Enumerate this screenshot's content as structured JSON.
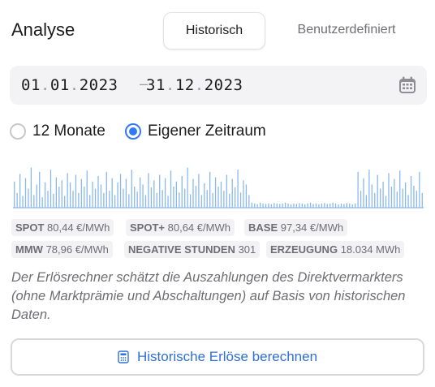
{
  "header": {
    "title": "Analyse"
  },
  "tabs": [
    {
      "label": "Historisch",
      "active": true
    },
    {
      "label": "Benutzerdefiniert",
      "active": false
    }
  ],
  "date_range": {
    "start": {
      "day": "01",
      "month": "01",
      "year": "2023"
    },
    "separator": "–",
    "end": {
      "day": "31",
      "month": "12",
      "year": "2023"
    },
    "calendar_icon": "calendar-icon"
  },
  "period_options": [
    {
      "label": "12 Monate",
      "selected": false
    },
    {
      "label": "Eigener Zeitraum",
      "selected": true
    }
  ],
  "stats": [
    {
      "key": "SPOT",
      "value": "80,44 €/MWh"
    },
    {
      "key": "SPOT+",
      "value": "80,64 €/MWh"
    },
    {
      "key": "BASE",
      "value": "97,34 €/MWh"
    },
    {
      "key": "MMW",
      "value": "78,96 €/MWh"
    },
    {
      "key": "NEGATIVE STUNDEN",
      "value": "301"
    },
    {
      "key": "ERZEUGUNG",
      "value": "18.034 MWh"
    }
  ],
  "description": "Der Erlösrechner schätzt die Auszahlungen des Direktvermarkters (ohne Marktprämie und Abschaltungen) auf Basis von historischen Daten.",
  "calculate_button": {
    "label": "Historische Erlöse berechnen",
    "icon": "calculator-icon"
  },
  "colors": {
    "accent": "#3478f6",
    "chart": "#8ab8ee",
    "button_text": "#2f6fd6"
  },
  "chart_data": {
    "type": "area",
    "series": [
      {
        "values": [
          0.62,
          0.35,
          0.8,
          0.28,
          0.7,
          0.45,
          0.95,
          0.3,
          0.55,
          0.85,
          0.25,
          0.6,
          0.4,
          0.9,
          0.33,
          0.72,
          0.5,
          0.65,
          0.28,
          0.82,
          0.6,
          0.4,
          0.78,
          0.35,
          0.68,
          0.5,
          0.88,
          0.3,
          0.62,
          0.45,
          0.75,
          0.55,
          0.35,
          0.85,
          0.4,
          0.7,
          0.3,
          0.6,
          0.8,
          0.45,
          0.68,
          0.32,
          0.9,
          0.5,
          0.38,
          0.72,
          0.55,
          0.3,
          0.82,
          0.48,
          0.65,
          0.35,
          0.78,
          0.42,
          0.7,
          0.28,
          0.88,
          0.5,
          0.62,
          0.36,
          0.75,
          0.45,
          0.95,
          0.32,
          0.68,
          0.52,
          0.8,
          0.3,
          0.58,
          0.42,
          0.85,
          0.35,
          0.72,
          0.5,
          0.62,
          0.4,
          0.78,
          0.33,
          0.68,
          0.48,
          0.9,
          0.36,
          0.65,
          0.55,
          0.3,
          0.12,
          0.1,
          0.08,
          0.12,
          0.1,
          0.09,
          0.1,
          0.08,
          0.11,
          0.1,
          0.09,
          0.1,
          0.12,
          0.1,
          0.08,
          0.1,
          0.09,
          0.11,
          0.1,
          0.08,
          0.1,
          0.12,
          0.09,
          0.1,
          0.08,
          0.1,
          0.11,
          0.09,
          0.1,
          0.12,
          0.1,
          0.08,
          0.1,
          0.09,
          0.11,
          0.1,
          0.08,
          0.1,
          0.85,
          0.4,
          0.7,
          0.3,
          0.9,
          0.55,
          0.35,
          0.78,
          0.45,
          0.62,
          0.28,
          0.82,
          0.5,
          0.68,
          0.38,
          0.88,
          0.45,
          0.6,
          0.3,
          0.75,
          0.52,
          0.4,
          0.85,
          0.35
        ]
      }
    ]
  }
}
